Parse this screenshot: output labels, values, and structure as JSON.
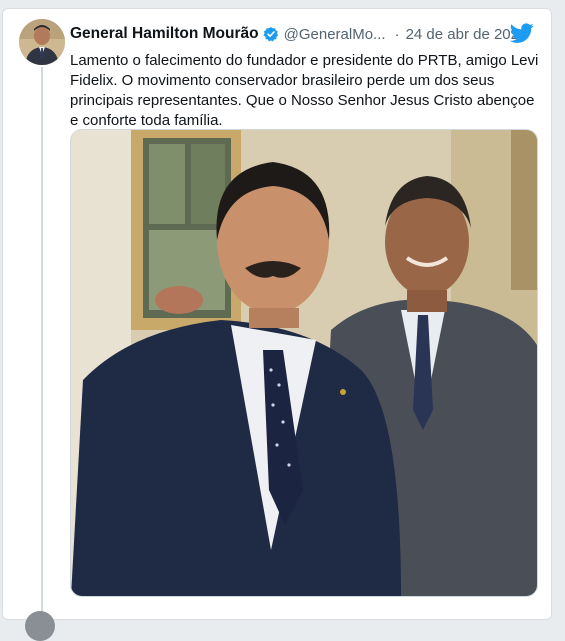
{
  "tweet": {
    "author_name": "General Hamilton Mourão",
    "handle": "@GeneralMo...",
    "separator": "·",
    "date": "24 de abr de 2021",
    "text": "Lamento o falecimento do fundador e presidente do PRTB, amigo Levi Fidelix. O movimento conservador brasileiro perde um dos seus principais representantes. Que o Nosso Senhor Jesus Cristo abençoe e conforte toda família."
  },
  "icons": {
    "verified": "verified-badge-icon",
    "brand": "twitter-bird-icon"
  },
  "colors": {
    "brand_blue": "#1d9bf0",
    "text_primary": "#0f1419",
    "text_secondary": "#536471",
    "thread_line": "#cfd9de"
  }
}
